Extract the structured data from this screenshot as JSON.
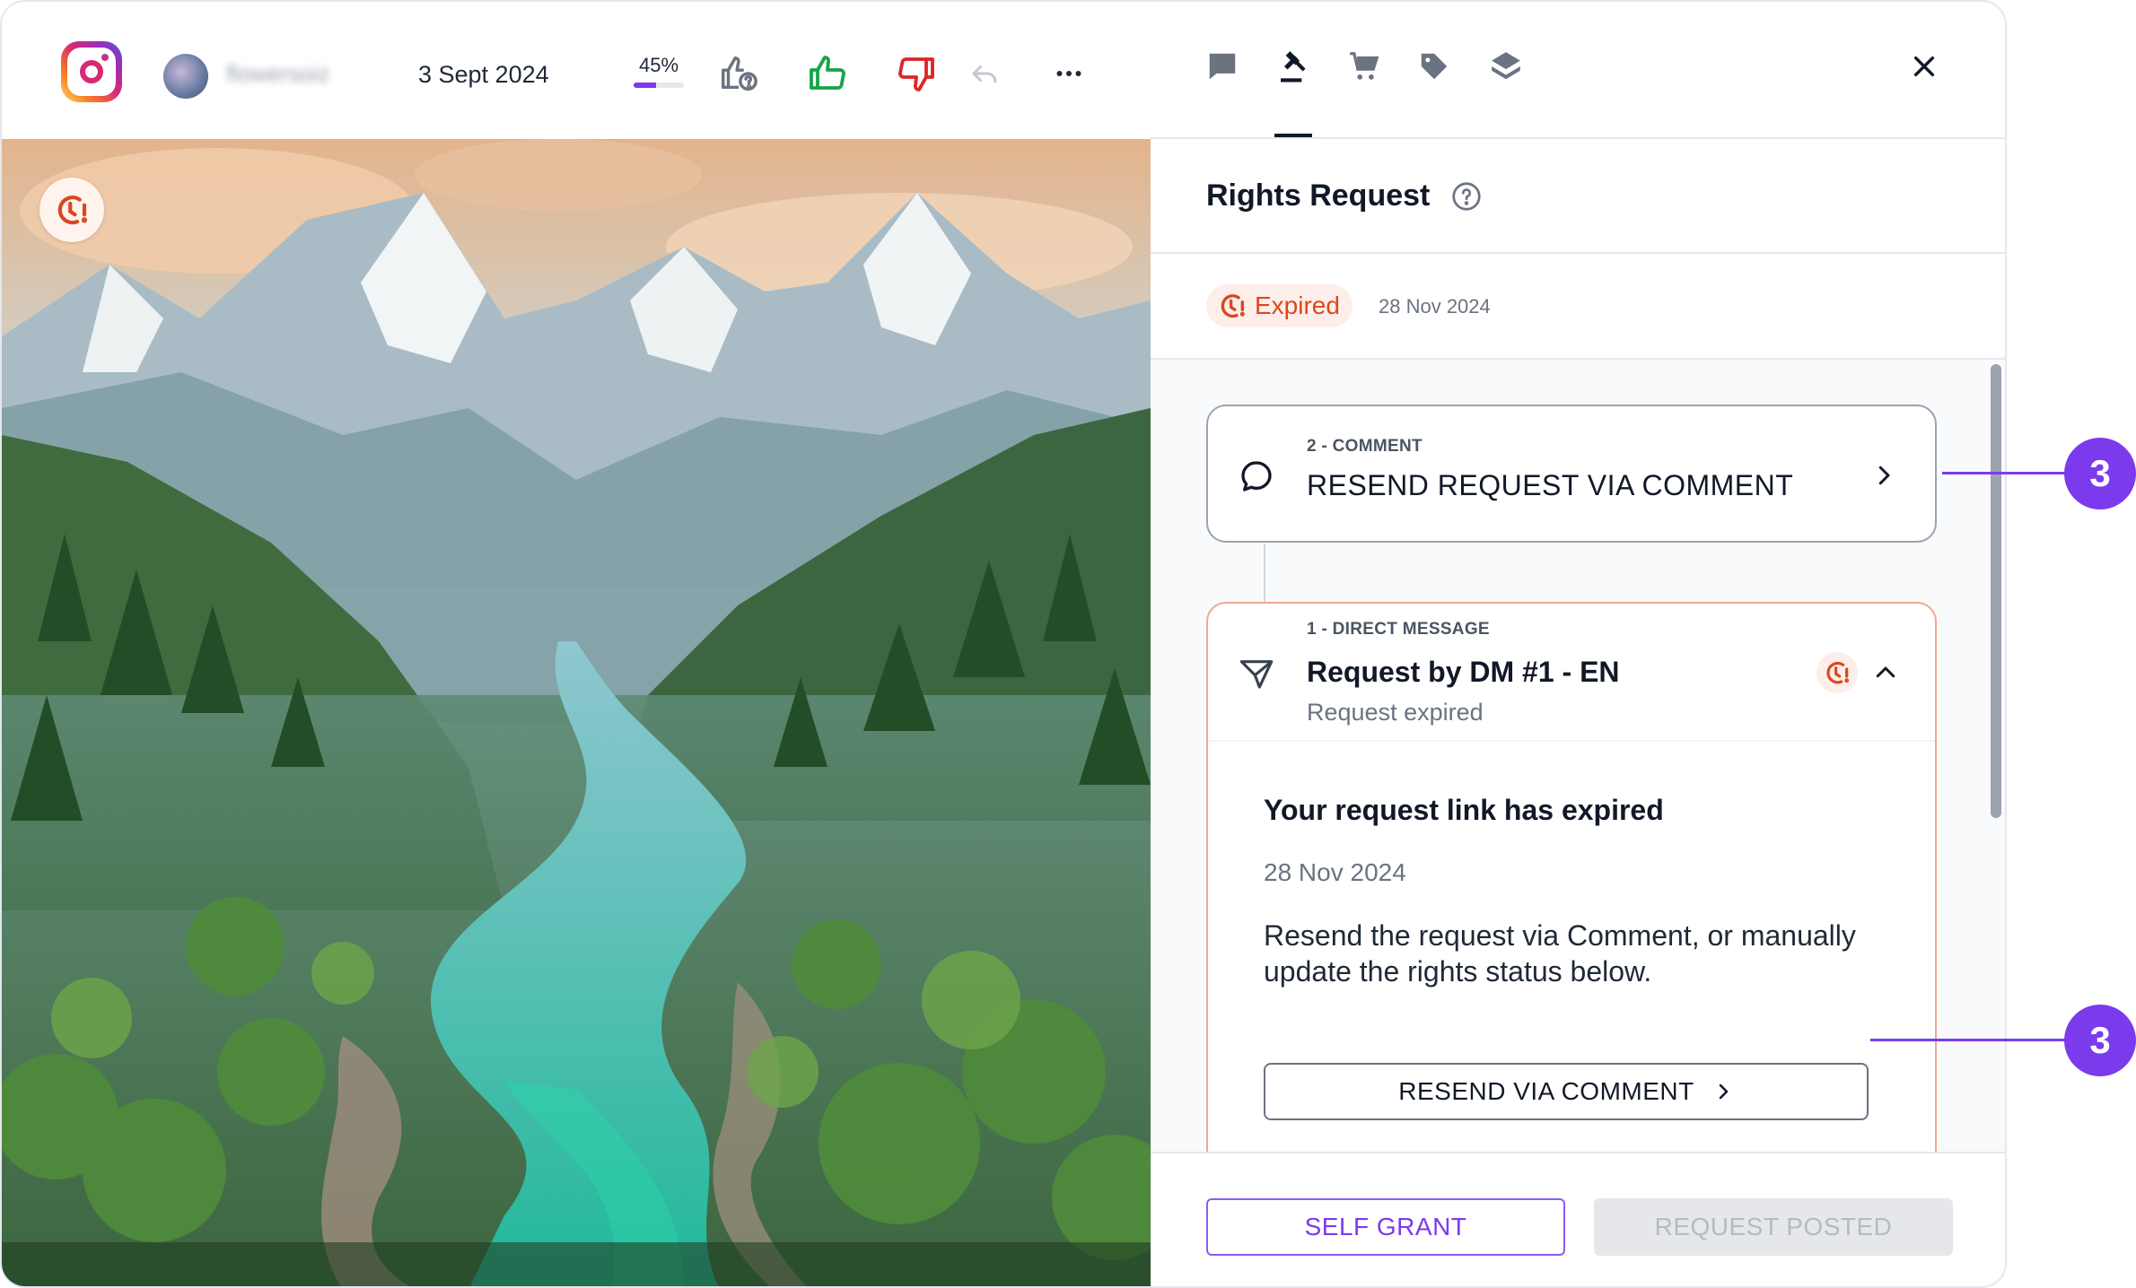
{
  "toolbar": {
    "username": "flowersoiz",
    "post_date": "3 Sept 2024",
    "score_label": "45%",
    "score_percent": 45
  },
  "icons": {
    "platform": "instagram-icon",
    "tabs": [
      "comment-icon",
      "gavel-icon",
      "cart-icon",
      "tag-icon",
      "layers-icon"
    ],
    "close": "close-icon"
  },
  "rights_request": {
    "title": "Rights Request",
    "status_label": "Expired",
    "status_date": "28 Nov 2024",
    "steps": [
      {
        "kicker": "2 - COMMENT",
        "title": "RESEND REQUEST VIA COMMENT"
      },
      {
        "kicker": "1 - DIRECT MESSAGE",
        "title": "Request by DM #1 - EN",
        "subtitle": "Request expired",
        "body_title": "Your request link has expired",
        "body_date": "28 Nov 2024",
        "body_text": "Resend the request via Comment, or manually update the rights status below.",
        "action_label": "RESEND VIA COMMENT"
      }
    ]
  },
  "footer": {
    "self_grant_label": "SELF GRANT",
    "request_posted_label": "REQUEST POSTED"
  },
  "callouts": [
    "3",
    "3"
  ],
  "colors": {
    "accent": "#7c3aed",
    "expired": "#d9481e",
    "like": "#16a34a",
    "dislike": "#dc2626"
  }
}
